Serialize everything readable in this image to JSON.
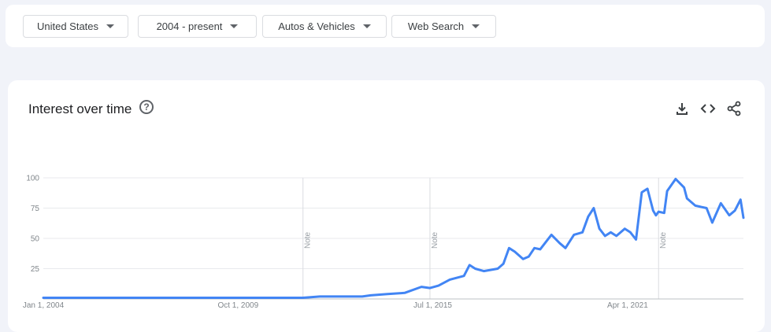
{
  "filters": {
    "region": "United States",
    "time_range": "2004 - present",
    "category": "Autos & Vehicles",
    "search_type": "Web Search"
  },
  "card": {
    "title": "Interest over time",
    "help_icon": "help-circle-icon",
    "actions": [
      "download-icon",
      "embed-code-icon",
      "share-icon"
    ]
  },
  "chart_data": {
    "type": "line",
    "title": "",
    "xlabel": "",
    "ylabel": "",
    "ylim": [
      0,
      100
    ],
    "yticks": [
      "25",
      "50",
      "75",
      "100"
    ],
    "xticks": [
      "Jan 1, 2004",
      "Oct 1, 2009",
      "Jul 1, 2015",
      "Apr 1, 2021"
    ],
    "annotations": [
      "Note",
      "Note",
      "Note"
    ],
    "line_color": "#4285f4",
    "grid": "horizontal",
    "series": [
      {
        "x": [
          "2004-01",
          "2005-01",
          "2006-01",
          "2007-01",
          "2008-01",
          "2009-01",
          "2010-01",
          "2011-01",
          "2011-09",
          "2012-03",
          "2012-06",
          "2013-06",
          "2013-09",
          "2014-03",
          "2014-09",
          "2015-03",
          "2015-06",
          "2015-09",
          "2016-01",
          "2016-06",
          "2016-08",
          "2016-10",
          "2017-01",
          "2017-06",
          "2017-08",
          "2017-10",
          "2017-12",
          "2018-03",
          "2018-05",
          "2018-07",
          "2018-09",
          "2019-01",
          "2019-04",
          "2019-06",
          "2019-09",
          "2019-12",
          "2020-02",
          "2020-04",
          "2020-06",
          "2020-08",
          "2020-10",
          "2020-12",
          "2021-03",
          "2021-05",
          "2021-07",
          "2021-09",
          "2021-11",
          "2022-01",
          "2022-02",
          "2022-03",
          "2022-05",
          "2022-06",
          "2022-09",
          "2022-12",
          "2023-01",
          "2023-04",
          "2023-08",
          "2023-10",
          "2024-01",
          "2024-04",
          "2024-06",
          "2024-08",
          "2024-09"
        ],
        "y": [
          1,
          1,
          1,
          1,
          1,
          1,
          1,
          1,
          1,
          2,
          2,
          2,
          3,
          4,
          5,
          10,
          9,
          11,
          16,
          19,
          28,
          25,
          23,
          25,
          29,
          42,
          39,
          33,
          35,
          42,
          41,
          53,
          46,
          42,
          53,
          55,
          68,
          75,
          58,
          52,
          55,
          52,
          58,
          55,
          49,
          88,
          91,
          73,
          69,
          72,
          71,
          89,
          99,
          92,
          83,
          77,
          75,
          63,
          79,
          69,
          73,
          82,
          67
        ]
      }
    ]
  }
}
